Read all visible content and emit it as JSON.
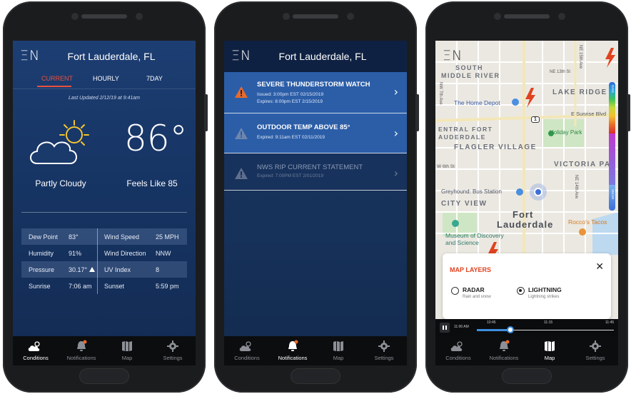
{
  "screen1": {
    "logo": "ΞN",
    "city": "Fort Lauderdale, FL",
    "tabs": [
      "CURRENT",
      "HOURLY",
      "7DAY"
    ],
    "last_updated": "Last Updated 2/12/19 at 9:41am",
    "temperature": "86°",
    "condition": "Partly Cloudy",
    "feels_like": "Feels Like 85",
    "details": {
      "dew_point_label": "Dew Point",
      "dew_point": "83°",
      "wind_speed_label": "Wind Speed",
      "wind_speed": "25 MPH",
      "humidity_label": "Humidity",
      "humidity": "91%",
      "wind_direction_label": "Wind Direction",
      "wind_direction": "NNW",
      "pressure_label": "Pressure",
      "pressure": "30.17°",
      "uv_index_label": "UV Index",
      "uv_index": "8",
      "sunrise_label": "Sunrise",
      "sunrise": "7:06 am",
      "sunset_label": "Sunset",
      "sunset": "5:59 pm"
    }
  },
  "screen2": {
    "logo": "ΞN",
    "city": "Fort Lauderdale, FL",
    "alerts": [
      {
        "title": "SEVERE THUNDERSTORM WATCH",
        "line1": "Issued: 3:00pm EST 02/15/2019",
        "line2": "Expires: 8:00pm EST 2/15/2019"
      },
      {
        "title": "OUTDOOR TEMP ABOVE 85°",
        "line1": "Expired: 9:11am EST 02/11/2019"
      },
      {
        "title": "NWS RIP CURRENT STATEMENT",
        "line1": "Expired: 7:00PM EST 2/01/2019"
      }
    ]
  },
  "screen3": {
    "logo": "ΞN",
    "map_labels": {
      "south": "SOUTH",
      "middle_river": "MIDDLE RIVER",
      "lake_ridge": "LAKE RIDGE",
      "home_depot": "The Home Depot",
      "central_fort": "ENTRAL FORT",
      "lauderdale_c": "AUDERDALE",
      "flagler": "FLAGLER VILLAGE",
      "victoria": "VICTORIA PA",
      "holiday_park": "Holiday Park",
      "greyhound": "Greyhound: Bus Station",
      "city_view": "CITY VIEW",
      "fort": "Fort",
      "lauderdale": "Lauderdale",
      "roccos": "Rocco's Tacos",
      "museum": "Museum of Discovery",
      "and_science": "and Science",
      "ne13": "NE 13th St",
      "sunrise_blvd": "E Sunrise Blvd",
      "w6th": "W 6th St",
      "ne15": "NE 15th Ave",
      "ne14": "NE 14th Ave",
      "nw7": "NW 7th Ave",
      "route1": "1"
    },
    "legend_labels": [
      "RAIN",
      "SNOW"
    ],
    "layers_title": "MAP LAYERS",
    "close": "✕",
    "radar_label": "RADAR",
    "radar_sub": "Rain and snow",
    "lightning_label": "LIGHTNING",
    "lightning_sub": "Lightning strikes",
    "timeline": {
      "start": "11:00 AM",
      "t1": "10:45",
      "t2": "11:15",
      "t3": "11:45"
    }
  },
  "nav": [
    "Conditions",
    "Notifications",
    "Map",
    "Settings"
  ],
  "colors": {
    "accent_red": "#e8503d",
    "alert_orange": "#e96a2a",
    "highlight_blue": "#2c5ea8",
    "nav_bg": "#0c0d0f"
  }
}
